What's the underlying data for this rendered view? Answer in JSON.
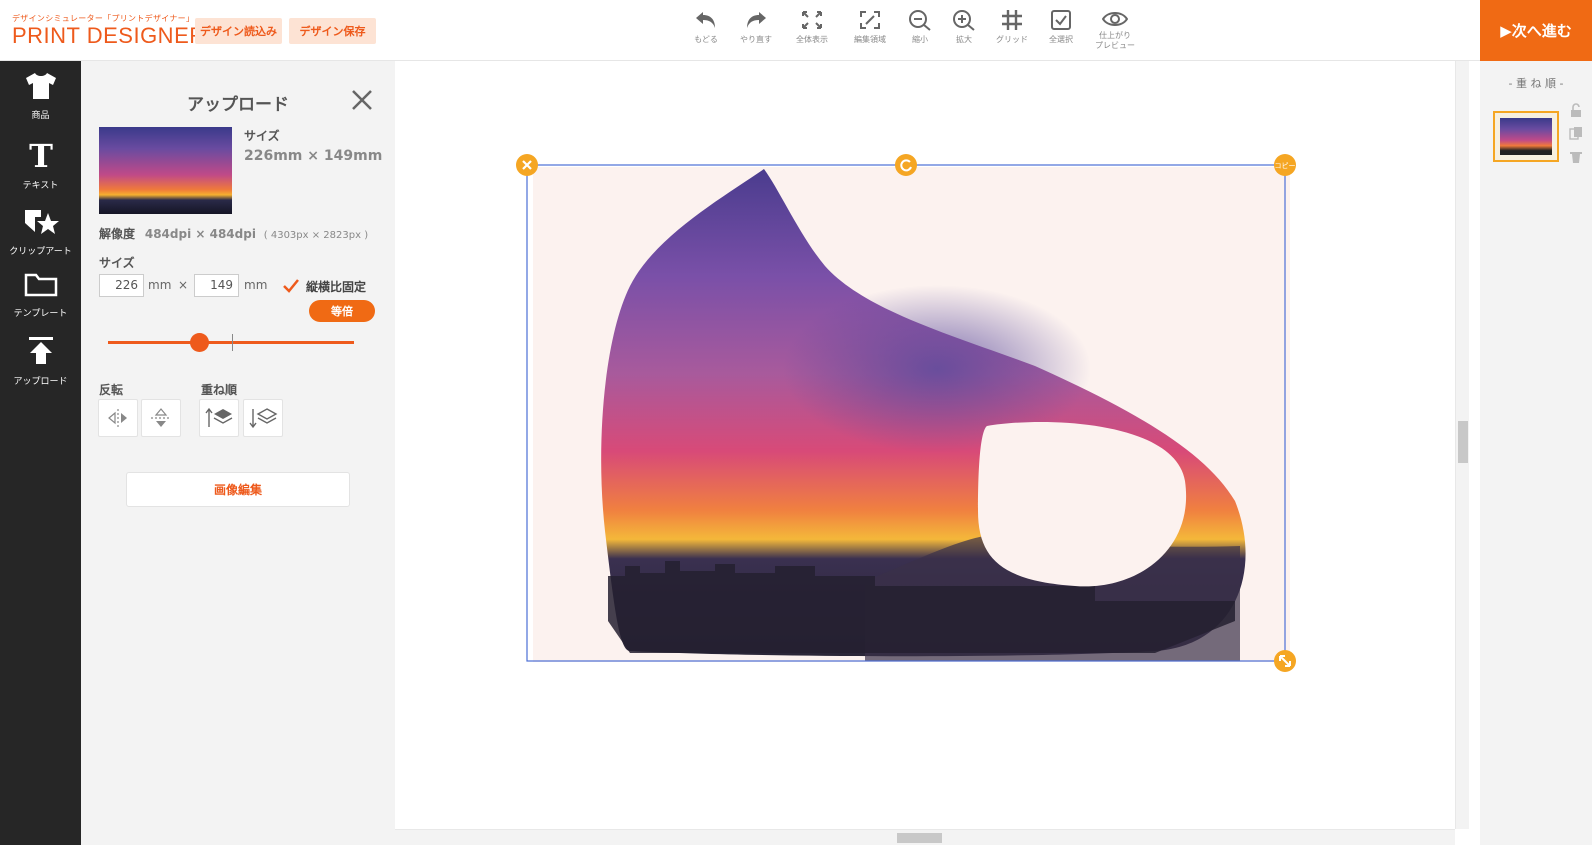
{
  "header": {
    "logo_sub": "デザインシミュレーター「プリントデザイナー」",
    "logo_main": "PRINT DESIGNER",
    "load_design": "デザイン読込み",
    "save_design": "デザイン保存",
    "next": "▶次へ進む"
  },
  "toolbar": [
    {
      "label": "もどる",
      "icon": "undo-icon"
    },
    {
      "label": "やり直す",
      "icon": "redo-icon"
    },
    {
      "label": "全体表示",
      "icon": "fit-icon"
    },
    {
      "label": "編集領域",
      "icon": "edit-area-icon"
    },
    {
      "label": "縮小",
      "icon": "zoom-out-icon"
    },
    {
      "label": "拡大",
      "icon": "zoom-in-icon"
    },
    {
      "label": "グリッド",
      "icon": "grid-icon"
    },
    {
      "label": "全選択",
      "icon": "select-all-icon"
    },
    {
      "label": "仕上がり",
      "label2": "プレビュー",
      "icon": "eye-icon"
    }
  ],
  "leftnav": [
    {
      "label": "商品",
      "icon": "tshirt-icon"
    },
    {
      "label": "テキスト",
      "icon": "text-icon"
    },
    {
      "label": "クリップアート",
      "icon": "clipart-icon"
    },
    {
      "label": "テンプレート",
      "icon": "folder-icon"
    },
    {
      "label": "アップロード",
      "icon": "upload-icon"
    }
  ],
  "panel": {
    "title": "アップロード",
    "size_label": "サイズ",
    "size_value": "226mm × 149mm",
    "resolution_label": "解像度",
    "resolution_value": "484dpi × 484dpi",
    "resolution_px": "( 4303px × 2823px )",
    "size2_label": "サイズ",
    "width": "226",
    "height": "149",
    "unit": "mm",
    "times": "×",
    "lock_ratio": "縦横比固定",
    "lock_ratio_checked": true,
    "equal_button": "等倍",
    "slider_value": 0.37,
    "flip_label": "反転",
    "order_label": "重ね順",
    "edit_button": "画像編集"
  },
  "canvas": {
    "copy_handle": "コピー"
  },
  "rightpanel": {
    "title": "- 重 ね 順 -"
  },
  "colors": {
    "accent": "#ee5a1c",
    "next_bg": "#f06a14",
    "handle": "#f5a623",
    "selection": "#4b6fd6",
    "nav_bg": "#262626"
  }
}
